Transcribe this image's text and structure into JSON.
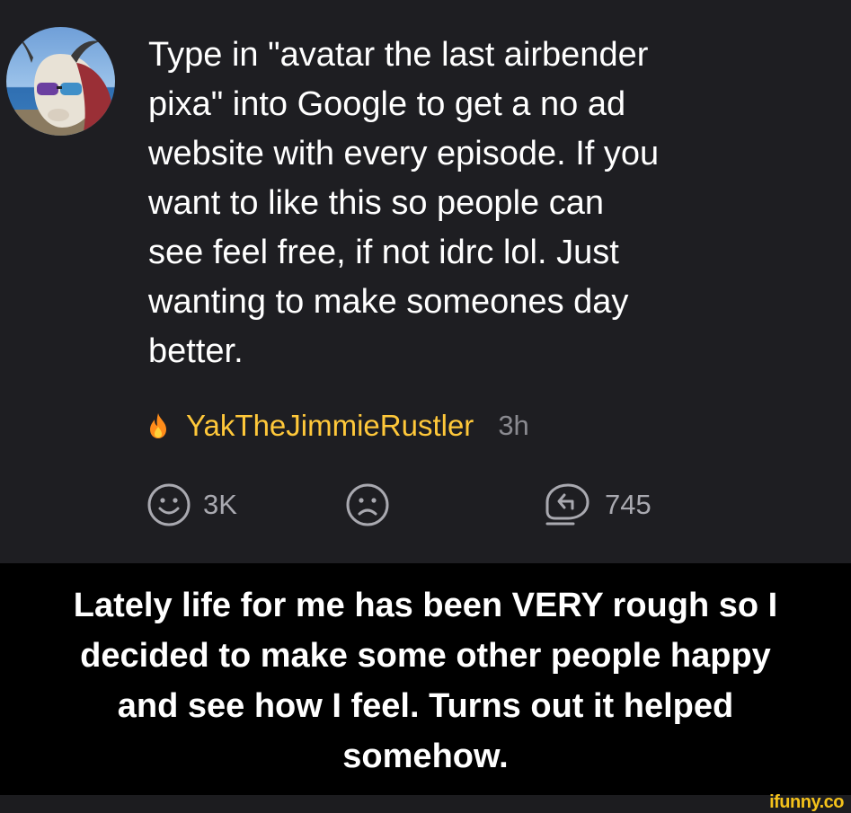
{
  "post": {
    "text": "Type in \"avatar the last airbender\npixa\" into Google to get a no ad\nwebsite with every episode. If you\nwant to like this so people can\nsee feel free, if not idrc lol. Just\nwanting to make someones day\nbetter.",
    "username": "YakTheJimmieRustler",
    "timestamp": "3h",
    "actions": {
      "smile_count": "3K",
      "reply_count": "745"
    },
    "username_color": "#ffc83a",
    "background_color": "#1e1e22"
  },
  "caption": {
    "text": "Lately life for me has been VERY rough so I\ndecided to make some other people happy\nand see how I feel. Turns out it helped\nsomehow."
  },
  "watermark": {
    "text": "ifunny.co",
    "color": "#f4c21b"
  },
  "icons": {
    "fire": "fire-icon",
    "smile": "smile-face-icon",
    "frown": "frown-face-icon",
    "reply": "reply-bubble-icon"
  }
}
